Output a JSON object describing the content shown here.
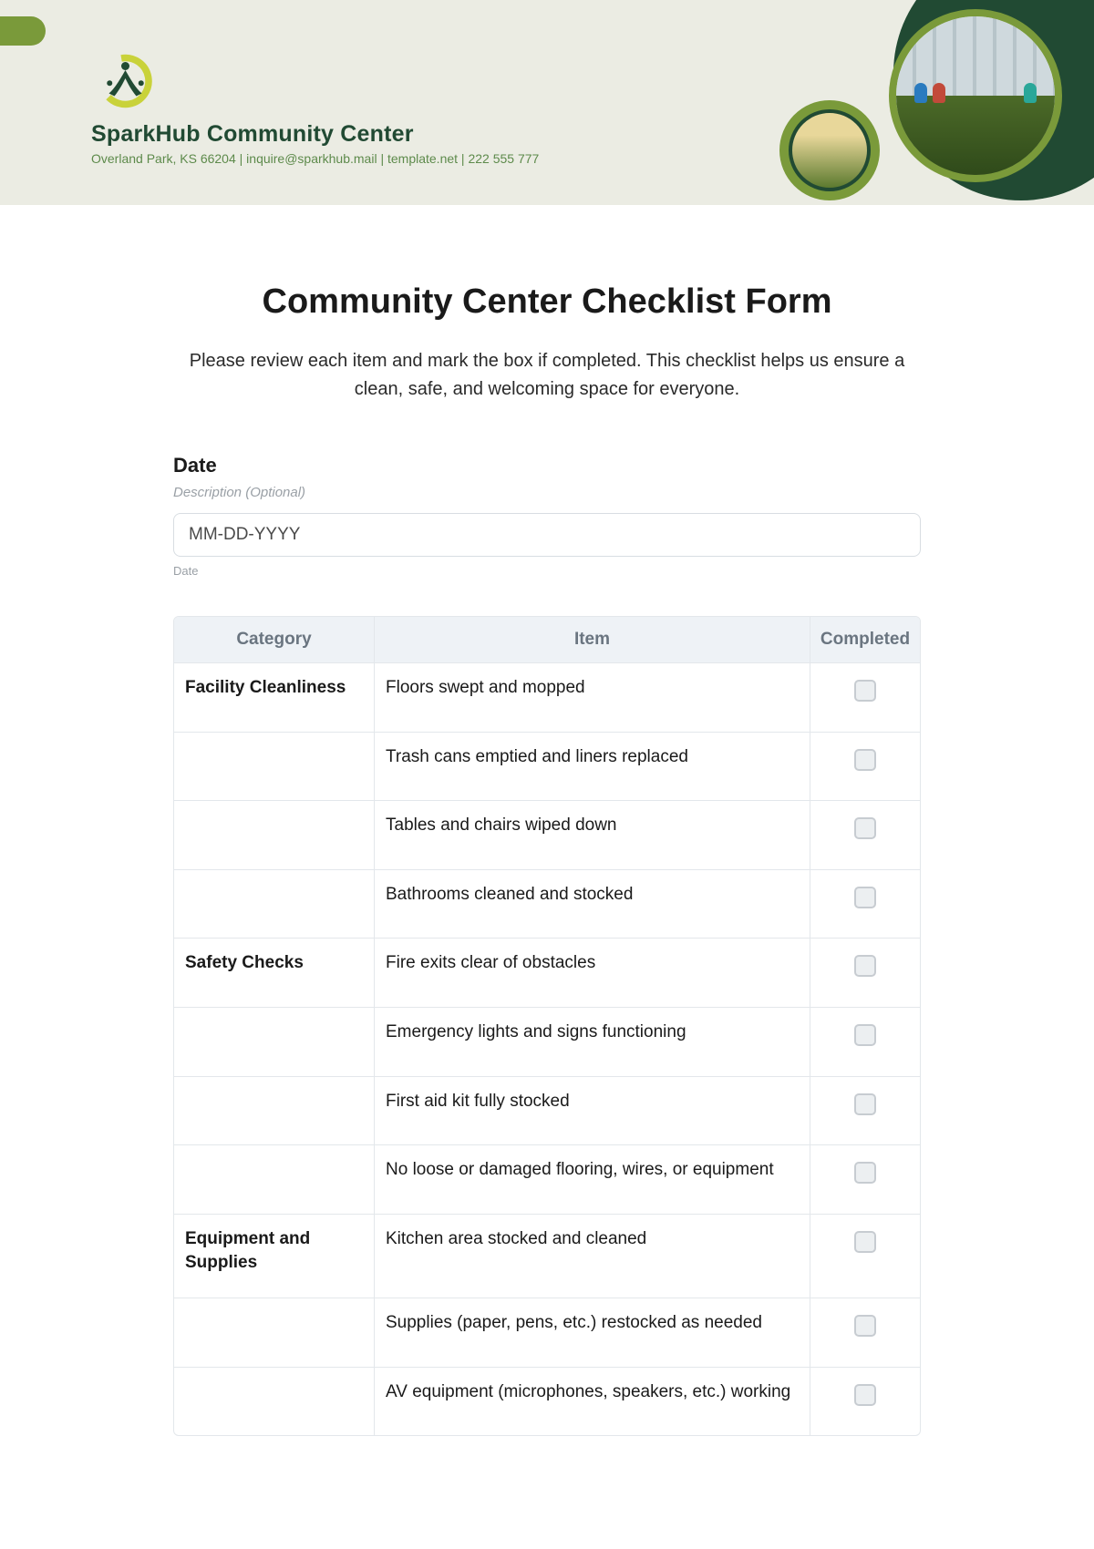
{
  "header": {
    "org_name": "SparkHub Community Center",
    "contact_line": "Overland Park, KS 66204 | inquire@sparkhub.mail | template.net | 222 555 777"
  },
  "form": {
    "title": "Community Center Checklist Form",
    "intro": "Please review each item and mark the box if completed. This checklist helps us ensure a clean, safe, and welcoming space for everyone.",
    "date_label": "Date",
    "date_description": "Description (Optional)",
    "date_placeholder": "MM-DD-YYYY",
    "date_sublabel": "Date"
  },
  "table": {
    "headers": {
      "category": "Category",
      "item": "Item",
      "completed": "Completed"
    },
    "rows": [
      {
        "category": "Facility Cleanliness",
        "item": "Floors swept and mopped"
      },
      {
        "category": "",
        "item": "Trash cans emptied and liners replaced"
      },
      {
        "category": "",
        "item": "Tables and chairs wiped down"
      },
      {
        "category": "",
        "item": "Bathrooms cleaned and stocked"
      },
      {
        "category": "Safety Checks",
        "item": "Fire exits clear of obstacles"
      },
      {
        "category": "",
        "item": "Emergency lights and signs functioning"
      },
      {
        "category": "",
        "item": "First aid kit fully stocked"
      },
      {
        "category": "",
        "item": "No loose or damaged flooring, wires, or equipment"
      },
      {
        "category": "Equipment and Supplies",
        "item": "Kitchen area stocked and cleaned"
      },
      {
        "category": "",
        "item": "Supplies (paper, pens, etc.) restocked as needed"
      },
      {
        "category": "",
        "item": "AV equipment (microphones, speakers, etc.) working"
      }
    ]
  }
}
